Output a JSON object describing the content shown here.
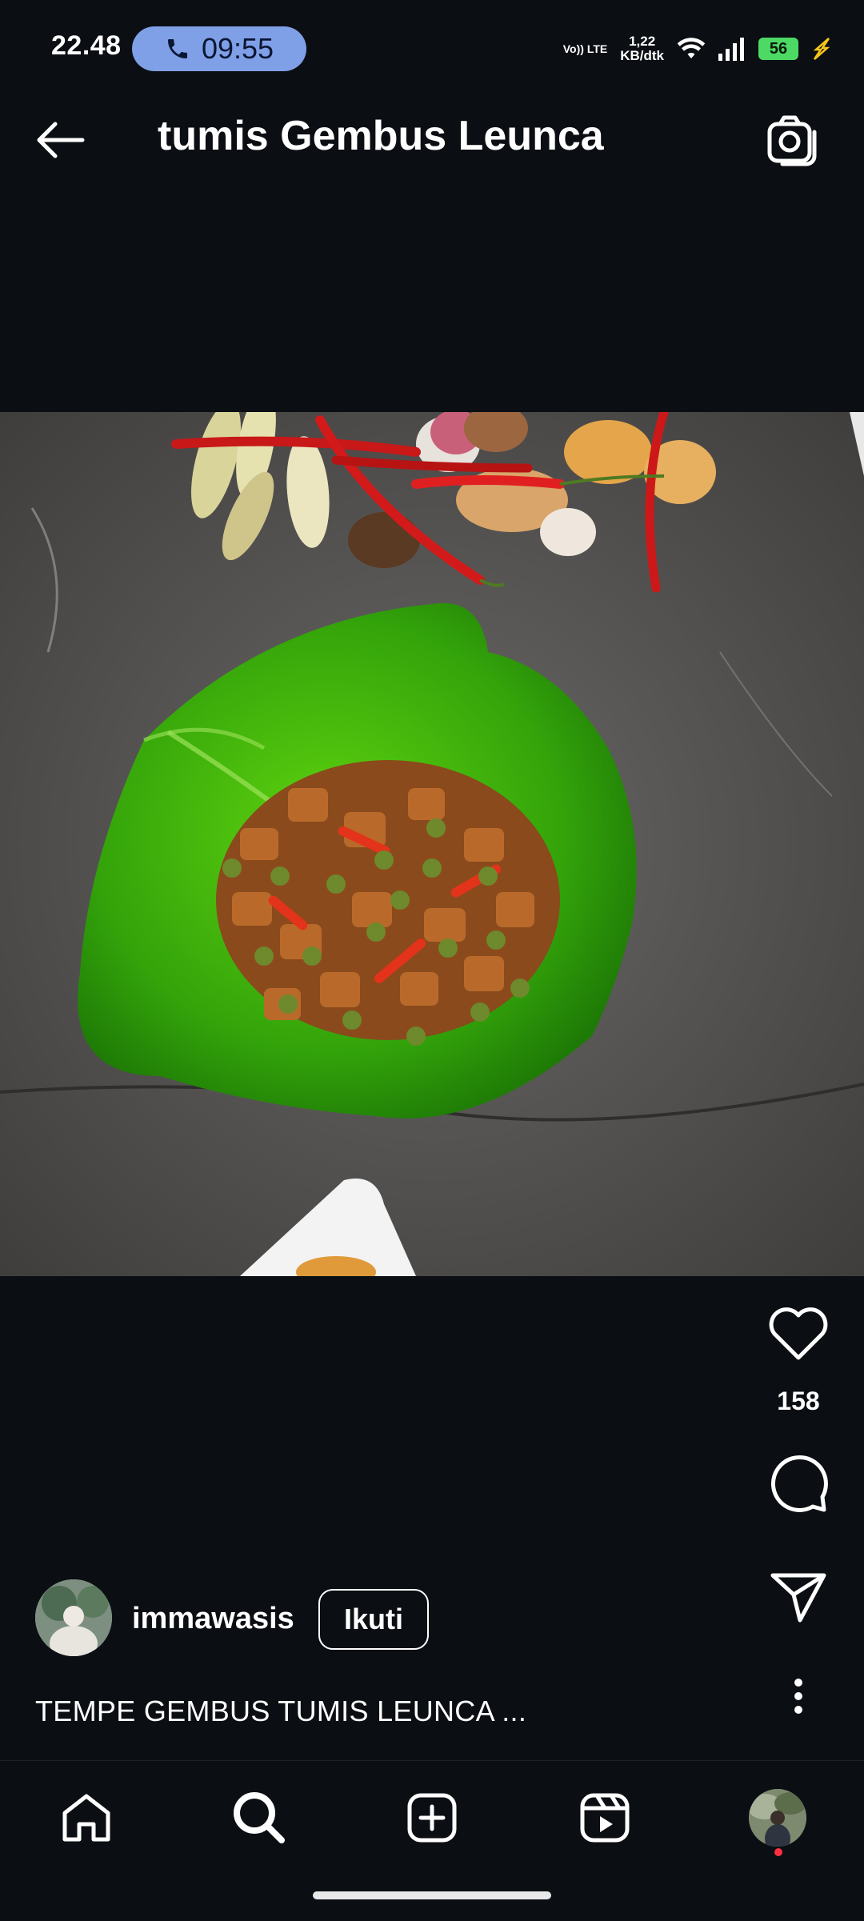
{
  "status_bar": {
    "time": "22.48",
    "call_time": "09:55",
    "network_label": "Vo)) LTE",
    "speed_value": "1,22",
    "speed_unit": "KB/dtk",
    "battery": "56"
  },
  "header": {
    "title": "tumis Gembus Leunca"
  },
  "post": {
    "likes": "158",
    "username": "immawasis",
    "follow_label": "Ikuti",
    "caption": "TEMPE GEMBUS TUMIS LEUNCA ..."
  },
  "icons": {
    "back": "arrow-left-icon",
    "camera": "camera-icon",
    "like": "heart-icon",
    "comment": "comment-icon",
    "share": "send-icon",
    "more": "more-vertical-icon",
    "home": "home-icon",
    "search": "search-icon",
    "create": "add-post-icon",
    "reels": "reels-icon"
  },
  "colors": {
    "background": "#0b0e13",
    "call_pill": "#7f9fe6",
    "battery": "#4cd964",
    "notification_dot": "#ff3040"
  }
}
